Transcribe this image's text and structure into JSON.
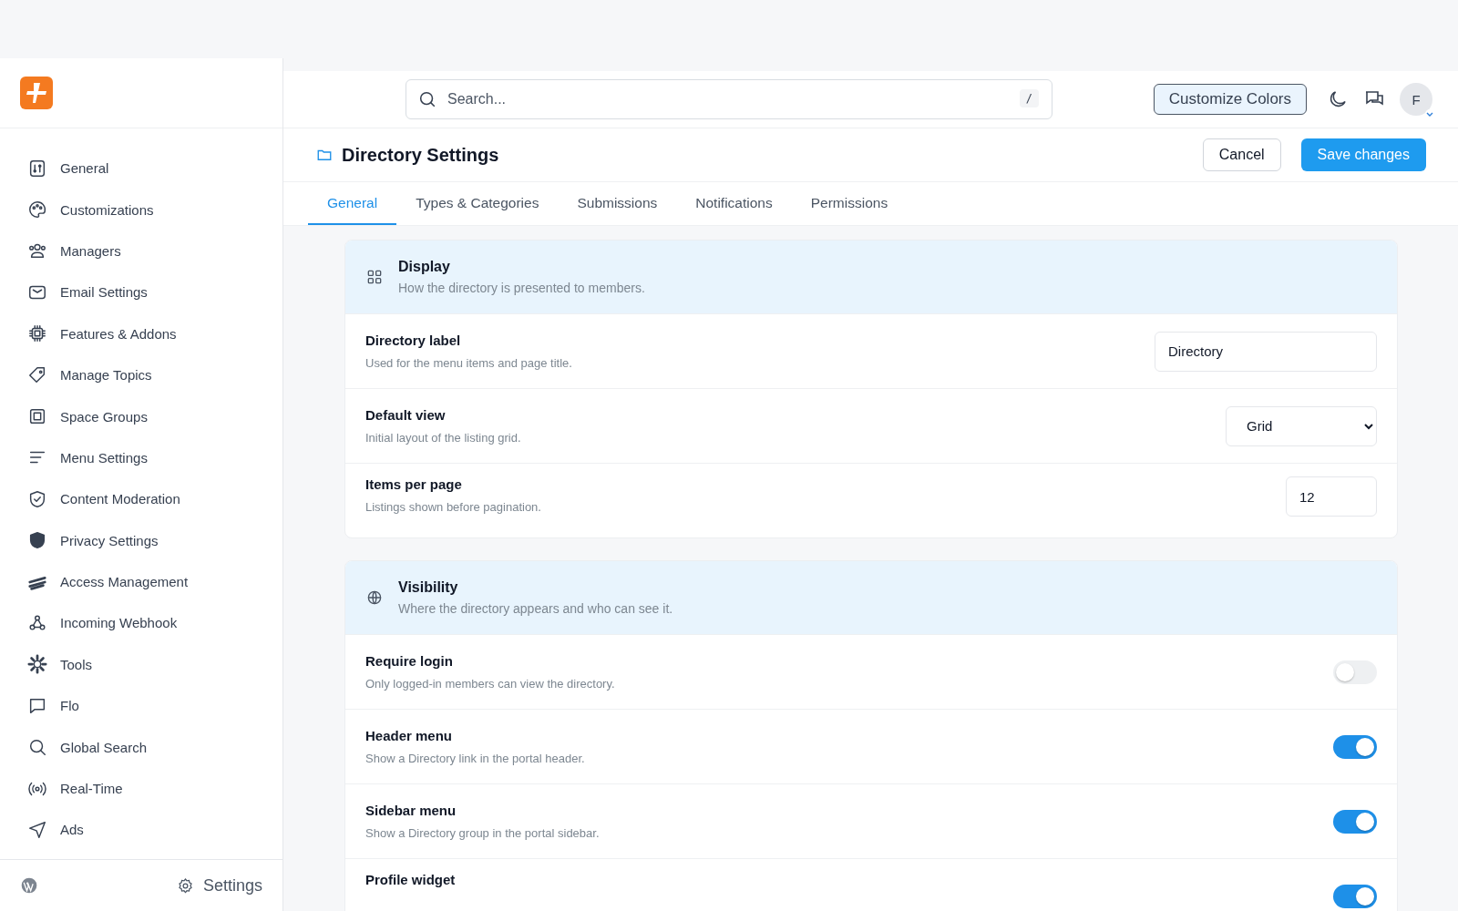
{
  "sidebar": {
    "items": [
      {
        "label": "General",
        "selected": false
      },
      {
        "label": "Customizations",
        "selected": false
      },
      {
        "label": "Managers",
        "selected": false
      },
      {
        "label": "Email Settings",
        "selected": false
      },
      {
        "label": "Features & Addons",
        "selected": false
      },
      {
        "label": "Manage Topics",
        "selected": false
      },
      {
        "label": "Space Groups",
        "selected": false
      },
      {
        "label": "Menu Settings",
        "selected": false
      },
      {
        "label": "Content Moderation",
        "selected": false
      },
      {
        "label": "Privacy Settings",
        "selected": false
      },
      {
        "label": "Access Management",
        "selected": false
      },
      {
        "label": "Incoming Webhook",
        "selected": false
      },
      {
        "label": "Tools",
        "selected": false
      },
      {
        "label": "Flo",
        "selected": false
      },
      {
        "label": "Global Search",
        "selected": false
      },
      {
        "label": "Real-Time",
        "selected": false
      },
      {
        "label": "Ads",
        "selected": false
      }
    ],
    "footer": {
      "settings_label": "Settings"
    }
  },
  "header": {
    "search": {
      "placeholder": "Search...",
      "shortcut": "/"
    },
    "customize_button": "Customize Colors",
    "avatar": "F"
  },
  "page": {
    "title": "Directory Settings",
    "cancel": "Cancel",
    "save": "Save changes"
  },
  "tabs": [
    {
      "label": "General",
      "selected": true
    },
    {
      "label": "Types & Categories",
      "selected": false
    },
    {
      "label": "Submissions",
      "selected": false
    },
    {
      "label": "Notifications",
      "selected": false
    },
    {
      "label": "Permissions",
      "selected": false
    }
  ],
  "sections": [
    {
      "title": "Display",
      "description": "How the directory is presented to members.",
      "kind": "grid",
      "rows": [
        {
          "kind": "text",
          "label": "Directory label",
          "description": "Used for the menu items and page title.",
          "value": "Directory"
        },
        {
          "kind": "select",
          "label": "Default view",
          "description": "Initial layout of the listing grid.",
          "value": "Grid"
        },
        {
          "kind": "number",
          "label": "Items per page",
          "description": "Listings shown before pagination.",
          "value": "12"
        }
      ]
    },
    {
      "title": "Visibility",
      "description": "Where the directory appears and who can see it.",
      "kind": "globe",
      "rows": [
        {
          "kind": "toggle",
          "label": "Require login",
          "description": "Only logged-in members can view the directory.",
          "on": false
        },
        {
          "kind": "toggle",
          "label": "Header menu",
          "description": "Show a Directory link in the portal header.",
          "on": true
        },
        {
          "kind": "toggle",
          "label": "Sidebar menu",
          "description": "Show a Directory group in the portal sidebar.",
          "on": true
        },
        {
          "kind": "toggle",
          "label": "Profile widget",
          "on": true
        }
      ]
    }
  ]
}
